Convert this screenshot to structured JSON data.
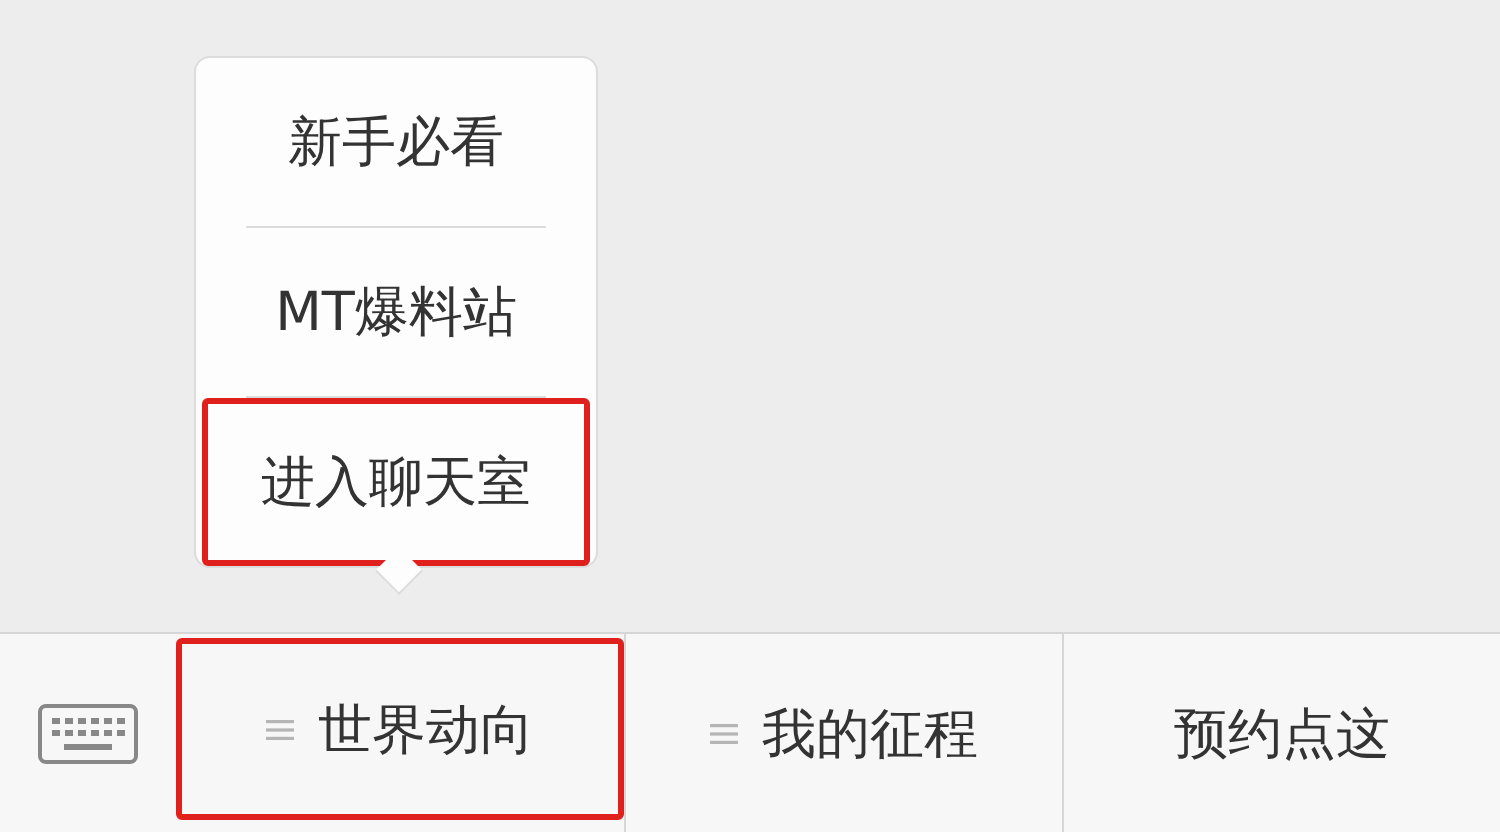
{
  "submenu": {
    "items": [
      {
        "label": "新手必看",
        "highlighted": false
      },
      {
        "label": "MT爆料站",
        "highlighted": false
      },
      {
        "label": "进入聊天室",
        "highlighted": true
      }
    ]
  },
  "menu_bar": {
    "tabs": [
      {
        "label": "世界动向",
        "has_submenu": true,
        "highlighted": true
      },
      {
        "label": "我的征程",
        "has_submenu": true,
        "highlighted": false
      },
      {
        "label": "预约点这",
        "has_submenu": false,
        "highlighted": false
      }
    ]
  }
}
